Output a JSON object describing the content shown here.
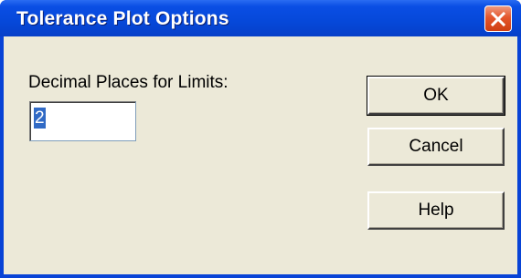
{
  "window": {
    "title": "Tolerance Plot Options",
    "close_icon": "close-icon"
  },
  "form": {
    "decimal_places_label": "Decimal Places for Limits:",
    "decimal_places_value": "2"
  },
  "buttons": {
    "ok_label": "OK",
    "cancel_label": "Cancel",
    "help_label": "Help"
  },
  "colors": {
    "titlebar": "#0648d9",
    "client_background": "#ece9d8",
    "close_button": "#e4562c",
    "selection": "#316ac5"
  }
}
